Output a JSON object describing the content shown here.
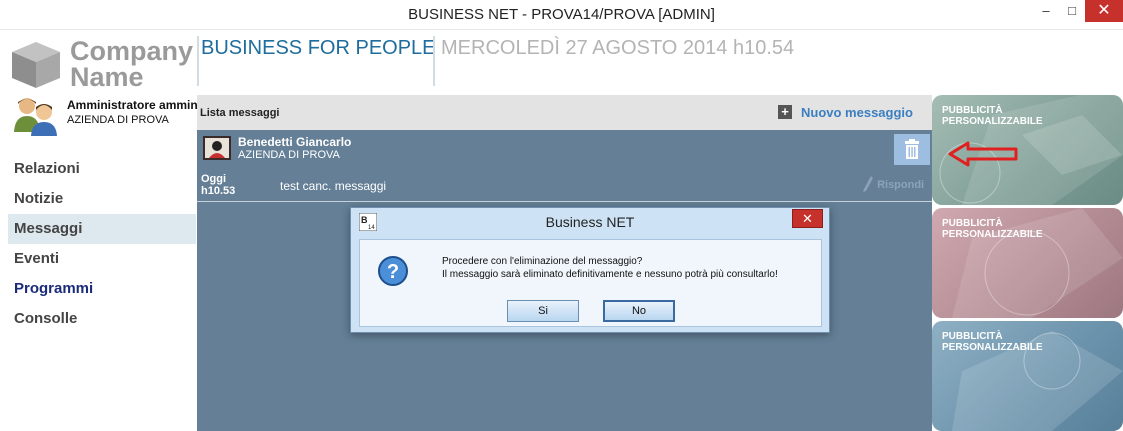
{
  "window": {
    "title": "BUSINESS NET - PROVA14/PROVA [ADMIN]",
    "minimize": "–",
    "maximize": "□",
    "close": "✕"
  },
  "logo": {
    "line1": "Company",
    "line2": "Name"
  },
  "user": {
    "name": "Amministratore amministratore",
    "company": "AZIENDA DI PROVA"
  },
  "nav": {
    "items": [
      {
        "label": "Relazioni"
      },
      {
        "label": "Notizie"
      },
      {
        "label": "Messaggi"
      },
      {
        "label": "Eventi"
      },
      {
        "label": "Programmi"
      },
      {
        "label": "Consolle"
      }
    ]
  },
  "header": {
    "brand": "BUSINESS FOR PEOPLE",
    "date": "MERCOLEDÌ 27 AGOSTO 2014 h10.54"
  },
  "messages": {
    "list_label": "Lista messaggi",
    "new_message": "Nuovo messaggio",
    "items": [
      {
        "sender": "Benedetti Giancarlo",
        "company": "AZIENDA DI PROVA",
        "day": "Oggi",
        "time": "h10.53",
        "text": "test canc. messaggi",
        "reply": "Rispondi"
      }
    ]
  },
  "ads": {
    "label_line1": "PUBBLICITÀ",
    "label_line2": "PERSONALIZZABILE"
  },
  "dialog": {
    "title": "Business NET",
    "line1": "Procedere con l'eliminazione del messaggio?",
    "line2": "Il messaggio sarà eliminato definitivamente e nessuno potrà più consultarlo!",
    "yes": "Si",
    "no": "No",
    "close": "✕"
  }
}
